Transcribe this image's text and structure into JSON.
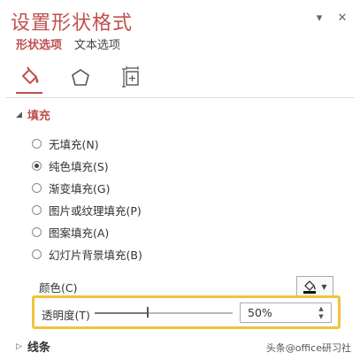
{
  "panel": {
    "title": "设置形状格式",
    "tabs": [
      {
        "label": "形状选项",
        "active": true
      },
      {
        "label": "文本选项",
        "active": false
      }
    ],
    "icons": [
      "fill-bucket-icon",
      "pentagon-icon",
      "size-properties-icon"
    ]
  },
  "fill": {
    "heading": "填充",
    "options": [
      {
        "label": "无填充(N)",
        "checked": false
      },
      {
        "label": "纯色填充(S)",
        "checked": true
      },
      {
        "label": "渐变填充(G)",
        "checked": false
      },
      {
        "label": "图片或纹理填充(P)",
        "checked": false
      },
      {
        "label": "图案填充(A)",
        "checked": false
      },
      {
        "label": "幻灯片背景填充(B)",
        "checked": false
      }
    ],
    "color_label": "颜色(C)",
    "transparency_label": "透明度(T)",
    "transparency_value": "50%",
    "transparency_fraction": 0.5
  },
  "line": {
    "heading": "线条"
  },
  "watermark": "头条@office研习社",
  "colors": {
    "accent": "#c0504d",
    "highlight": "#f2c23a"
  }
}
